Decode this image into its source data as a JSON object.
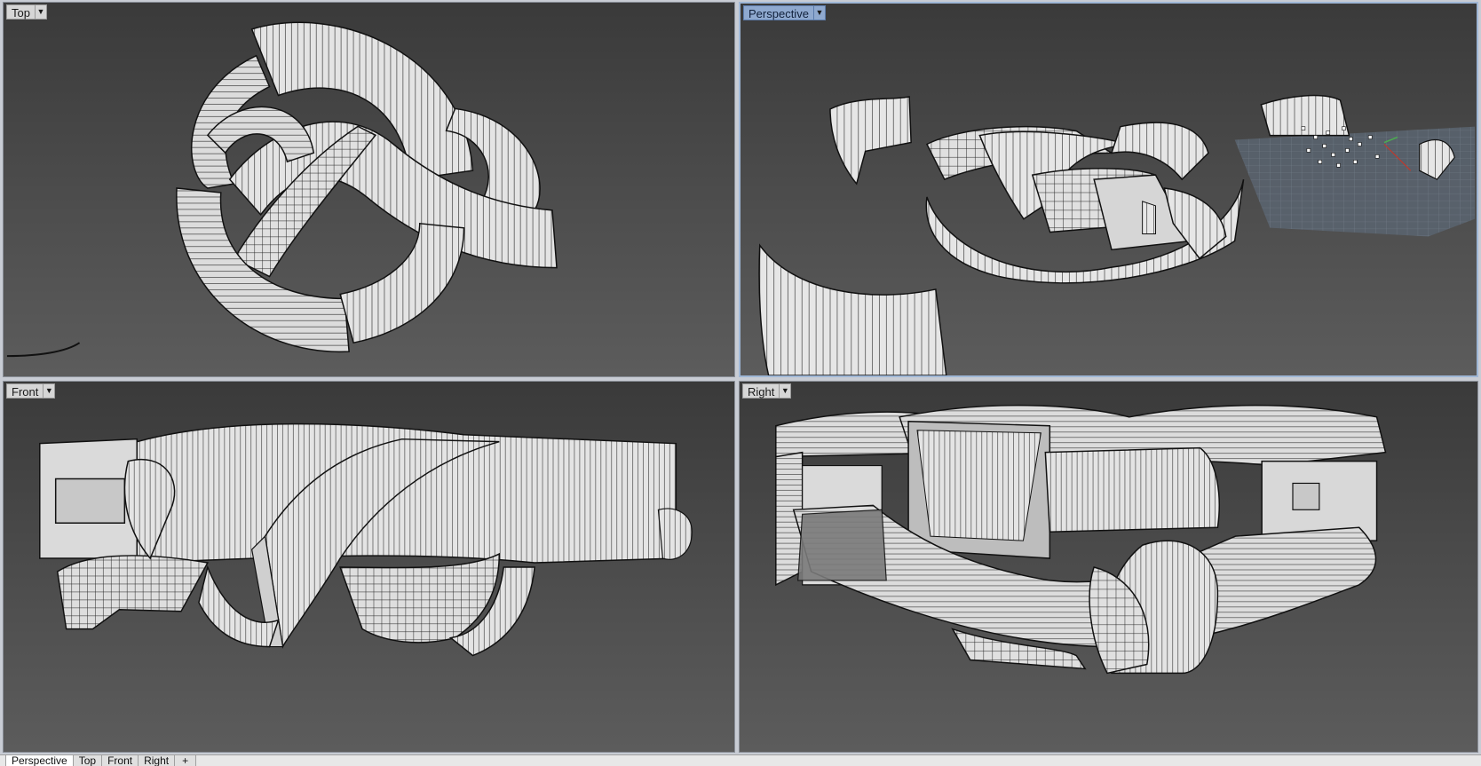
{
  "viewports": {
    "top": {
      "label": "Top"
    },
    "perspective": {
      "label": "Perspective"
    },
    "front": {
      "label": "Front"
    },
    "right": {
      "label": "Right"
    }
  },
  "tabs": [
    {
      "label": "Perspective"
    },
    {
      "label": "Top"
    },
    {
      "label": "Front"
    },
    {
      "label": "Right"
    },
    {
      "label": "+"
    }
  ],
  "icons": {
    "viewport_menu": "chevron-down-icon",
    "add_tab": "plus-icon"
  },
  "colors": {
    "viewport_bg_top": "#3a3a3a",
    "viewport_bg_bottom": "#5c5c5c",
    "active_label": "#8fa9cf",
    "surface": "#e2e2e2",
    "wire": "#111111"
  }
}
